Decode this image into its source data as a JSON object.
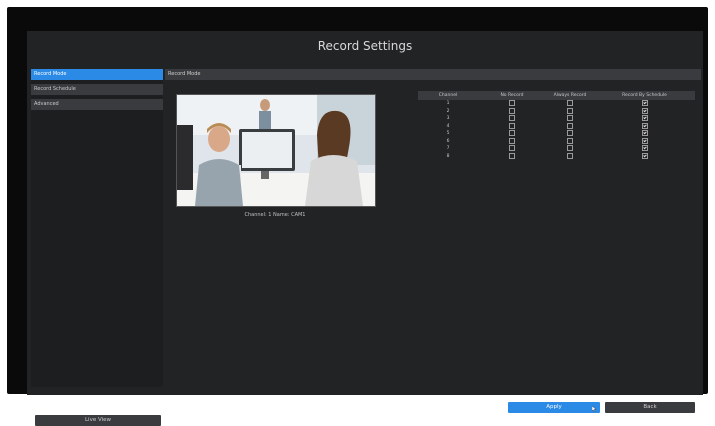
{
  "window": {
    "title": "Record Settings"
  },
  "sidebar": {
    "items": [
      {
        "label": "Record Mode",
        "active": true
      },
      {
        "label": "Record Schedule",
        "active": false
      },
      {
        "label": "Advanced",
        "active": false
      }
    ],
    "live_view_label": "Live View"
  },
  "main": {
    "section_title": "Record Mode",
    "preview_caption": "Channel: 1  Name: CAM1",
    "table": {
      "headers": [
        "Channel",
        "No Record",
        "Always Record",
        "Record By Schedule"
      ],
      "rows": [
        {
          "channel": "1",
          "no_record": false,
          "always_record": false,
          "by_schedule": true
        },
        {
          "channel": "2",
          "no_record": false,
          "always_record": false,
          "by_schedule": true
        },
        {
          "channel": "3",
          "no_record": false,
          "always_record": false,
          "by_schedule": true
        },
        {
          "channel": "4",
          "no_record": false,
          "always_record": false,
          "by_schedule": true
        },
        {
          "channel": "5",
          "no_record": false,
          "always_record": false,
          "by_schedule": true
        },
        {
          "channel": "6",
          "no_record": false,
          "always_record": false,
          "by_schedule": true
        },
        {
          "channel": "7",
          "no_record": false,
          "always_record": false,
          "by_schedule": true
        },
        {
          "channel": "8",
          "no_record": false,
          "always_record": false,
          "by_schedule": true
        }
      ]
    }
  },
  "footer": {
    "apply_label": "Apply",
    "back_label": "Back"
  },
  "colors": {
    "accent": "#2a8ae6",
    "panel": "#222325",
    "button": "#3a3b3e"
  },
  "icons": {
    "cursor": "mouse-pointer-icon"
  }
}
